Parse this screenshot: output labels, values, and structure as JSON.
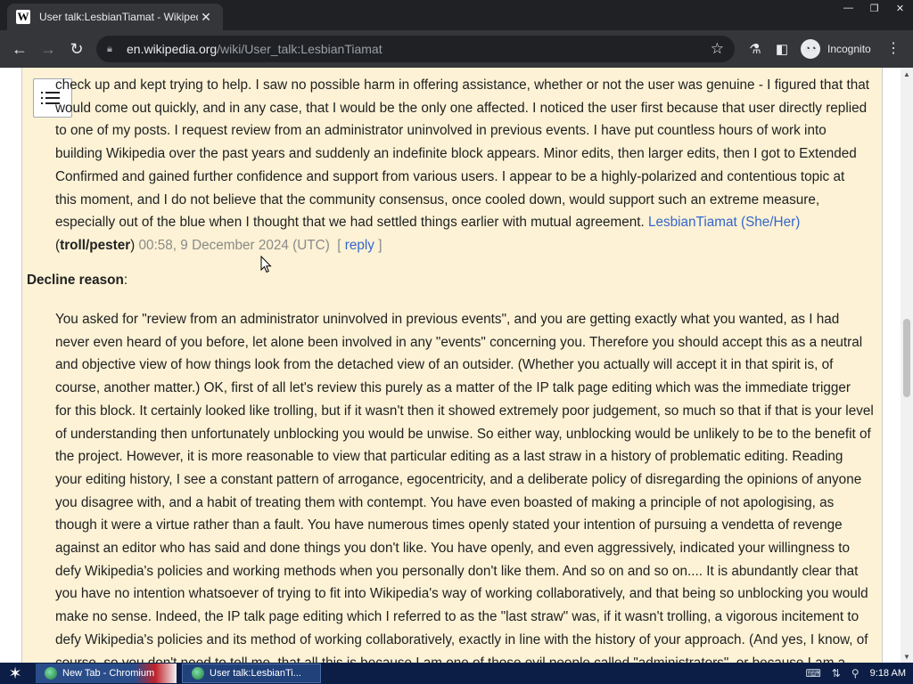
{
  "browser": {
    "tab_title": "User talk:LesbianTiamat - Wikipedia",
    "tab_favicon": "W",
    "url_host": "en.wikipedia.org",
    "url_path": "/wiki/User_talk:LesbianTiamat",
    "profile_label": "Incognito"
  },
  "page": {
    "top_paragraph_lines": [
      "check up and kept trying to help. I saw no possible harm in offering assistance, whether or not the user was genuine - I figured that that",
      "would come out quickly, and in any case, that I would be the only one affected. I noticed the user first because that user directly replied",
      "to one of my posts. I request review from an administrator uninvolved in previous events. I have put countless hours of work into",
      "building Wikipedia over the past years and suddenly an indefinite block appears. Minor edits, then larger edits, then I got to Extended",
      "Confirmed and gained further confidence and support from various users. I appear to be a highly-polarized and contentious topic at",
      "this moment, and I do not believe that the community consensus, once cooled down, would support such an extreme measure,",
      "especially out of the blue when I thought that we had settled things earlier with mutual agreement."
    ],
    "signature_user": "LesbianTiamat (She/Her)",
    "signature_talk": "troll/pester",
    "signature_timestamp": "00:58, 9 December 2024 (UTC)",
    "reply_link": "reply",
    "decline_heading": "Decline reason",
    "decline_lines": [
      "You asked for \"review from an administrator uninvolved in previous events\", and you are getting exactly what you wanted, as I had",
      "never even heard of you before, let alone been involved in any \"events\" concerning you. Therefore you should accept this as a neutral",
      "and objective view of how things look from the detached view of an outsider. (Whether you actually will accept it in that spirit is, of",
      "course, another matter.) OK, first of all let's review this purely as a matter of the IP talk page editing which was the immediate trigger",
      "for this block. It certainly looked like trolling, but if it wasn't then it showed extremely poor judgement, so much so that if that is your level",
      "of understanding then unfortunately unblocking you would be unwise. So either way, unblocking would be unlikely to be to the benefit of",
      "the project. However, it is more reasonable to view that particular editing as a last straw in a history of problematic editing. Reading",
      "your editing history, I see a constant pattern of arrogance, egocentricity, and a deliberate policy of disregarding the opinions of anyone",
      "you disagree with, and a habit of treating them with contempt. You have even boasted of making a principle of not apologising, as",
      "though it were a virtue rather than a fault. You have numerous times openly stated your intention of pursuing a vendetta of revenge",
      "against an editor who has said and done things you don't like. You have openly, and even aggressively, indicated your willingness to",
      "defy Wikipedia's policies and working methods when you personally don't like them. And so on and so on.... It is abundantly clear that",
      "you have no intention whatsoever of trying to fit into Wikipedia's way of working collaboratively, and that being so unblocking you would",
      "make no sense. Indeed, the IP talk page editing which I referred to as the \"last straw\" was, if it wasn't trolling, a vigorous incitement to",
      "defy Wikipedia's policies and its method of working collaboratively, exactly in line with the history of your approach. (And yes, I know, of",
      "course, so you don't need to tell me, that all this is because I am one of those evil people called \"administrators\", or because I am a"
    ]
  },
  "taskbar": {
    "task1_label": "New Tab - Chromium",
    "task2_label": "User talk:LesbianTi...",
    "clock": "9:18 AM"
  },
  "icons": {
    "tab": "wikipedia-favicon",
    "back": "back-arrow-icon",
    "forward": "forward-arrow-icon",
    "reload": "reload-icon",
    "lock": "lock-icon",
    "star": "bookmark-star-icon",
    "extensions": "flask-icon",
    "sidebar": "side-panel-icon",
    "incognito": "incognito-icon",
    "menu": "kebab-menu-icon",
    "toc": "table-of-contents-icon"
  },
  "colors": {
    "chrome_dark": "#202124",
    "chrome_toolbar": "#35363a",
    "content_bg": "#fdf2d5",
    "link": "#3366cc",
    "timestamp": "#8a8a8a",
    "taskbar": "#0c1e46"
  }
}
